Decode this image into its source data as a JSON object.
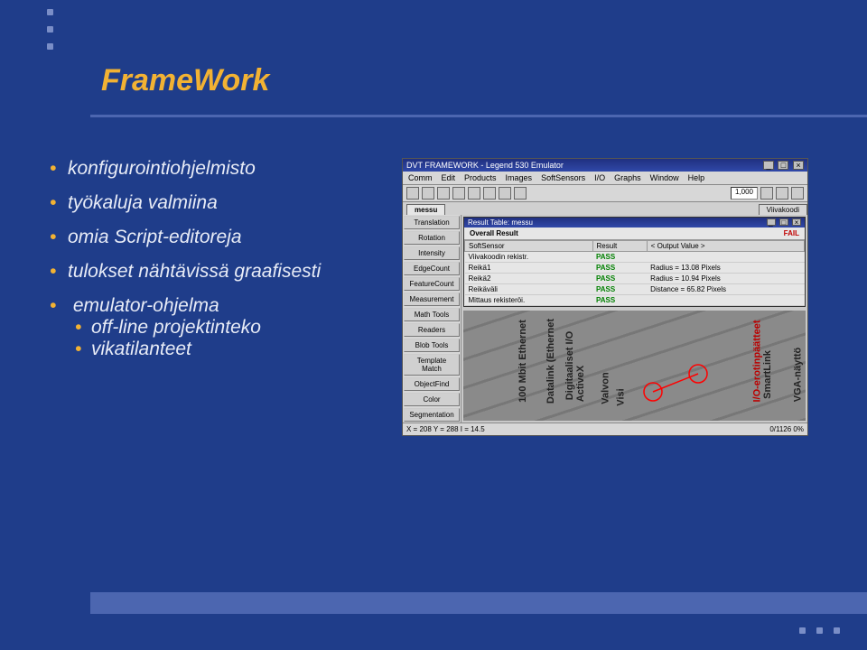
{
  "slide": {
    "title": "FrameWork",
    "bullets": [
      "konfigurointiohjelmisto",
      "työkaluja valmiina",
      "omia Script-editoreja",
      "tulokset nähtävissä graafisesti",
      "emulator-ohjelma"
    ],
    "sub_bullets": [
      "off-line projektinteko",
      "vikatilanteet"
    ]
  },
  "app_window": {
    "title": "DVT FRAMEWORK - Legend 530 Emulator",
    "menu": [
      "Comm",
      "Edit",
      "Products",
      "Images",
      "SoftSensors",
      "I/O",
      "Graphs",
      "Window",
      "Help"
    ],
    "counter": "1,000",
    "tabs_left": [
      "messu"
    ],
    "tabs_right": [
      "Viivakoodi"
    ],
    "left_buttons": [
      "Translation",
      "Rotation",
      "Intensity",
      "EdgeCount",
      "FeatureCount",
      "Measurement",
      "Math Tools",
      "Readers",
      "Blob Tools",
      "Template Match",
      "ObjectFind",
      "Color",
      "Segmentation"
    ],
    "result_panel": {
      "title": "Result Table: messu",
      "overall_label": "Overall Result",
      "overall_value": "FAIL",
      "columns": [
        "SoftSensor",
        "Result",
        "< Output Value >"
      ],
      "rows": [
        {
          "name": "Viivakoodin rekistr.",
          "result": "PASS",
          "value": ""
        },
        {
          "name": "Reikä1",
          "result": "PASS",
          "value": "Radius = 13.08 Pixels"
        },
        {
          "name": "Reikä2",
          "result": "PASS",
          "value": "Radius = 10.94 Pixels"
        },
        {
          "name": "Reikäväli",
          "result": "PASS",
          "value": "Distance = 65.82 Pixels"
        },
        {
          "name": "Mittaus rekisteröi.",
          "result": "PASS",
          "value": ""
        }
      ]
    },
    "image_labels": [
      "100 Mbit Ethernet",
      "Datalink (Ethernet",
      "Digitaaliset I/O",
      "ActiveX",
      "Valvon",
      "Visi",
      "I/O-erotinpäätteet",
      "SmartLink",
      "VGA-näyttö"
    ],
    "statusbar_left": "X = 208  Y = 288  I = 14.5",
    "statusbar_right": "0/1126  0%"
  }
}
